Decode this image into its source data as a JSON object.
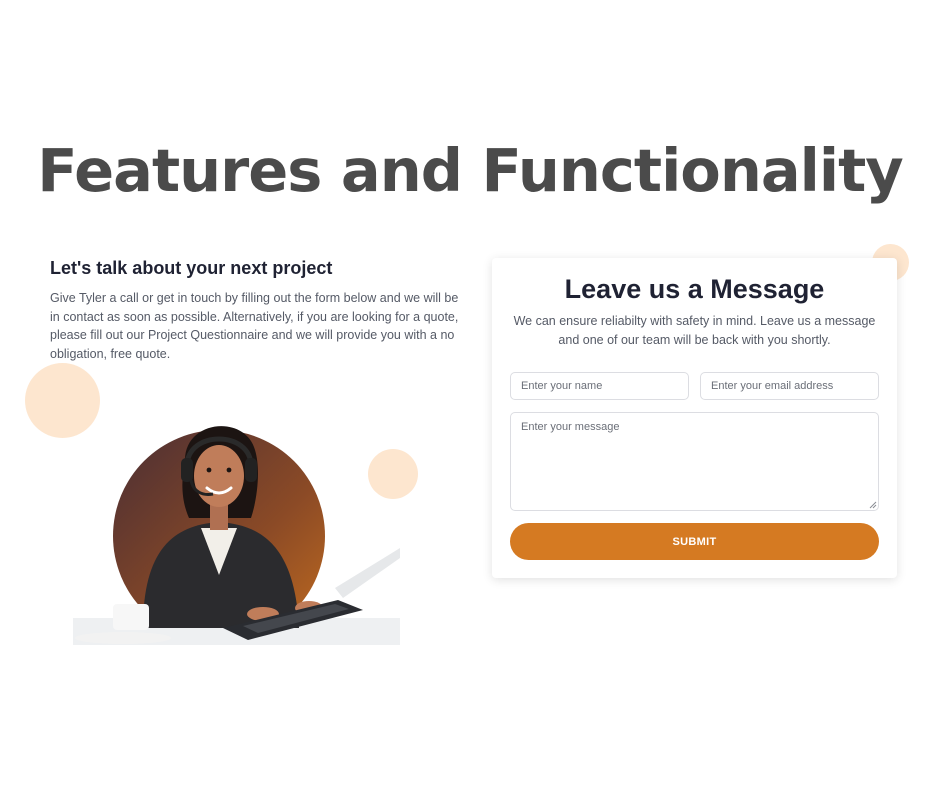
{
  "page": {
    "title": "Features and Functionality"
  },
  "left": {
    "heading": "Let's talk about your next project",
    "text": "Give Tyler a call or get in touch by filling out the form below and we will be in contact as soon as possible. Alternatively, if you are looking for a quote, please fill out our Project Questionnaire and we will provide you with a no obligation, free quote."
  },
  "form": {
    "title": "Leave us a Message",
    "subtitle": "We can ensure reliabilty with safety in mind. Leave us a message and one of our team will be back with you shortly.",
    "name_placeholder": "Enter your name",
    "email_placeholder": "Enter your email address",
    "message_placeholder": "Enter your message",
    "submit_label": "SUBMIT"
  },
  "colors": {
    "accent": "#d57a22",
    "decor": "#fde6cf",
    "heading": "#1f2233",
    "title": "#4b4b4b"
  },
  "icons": {
    "hero": "support-agent-photo",
    "resize": "resize-grip-icon"
  }
}
